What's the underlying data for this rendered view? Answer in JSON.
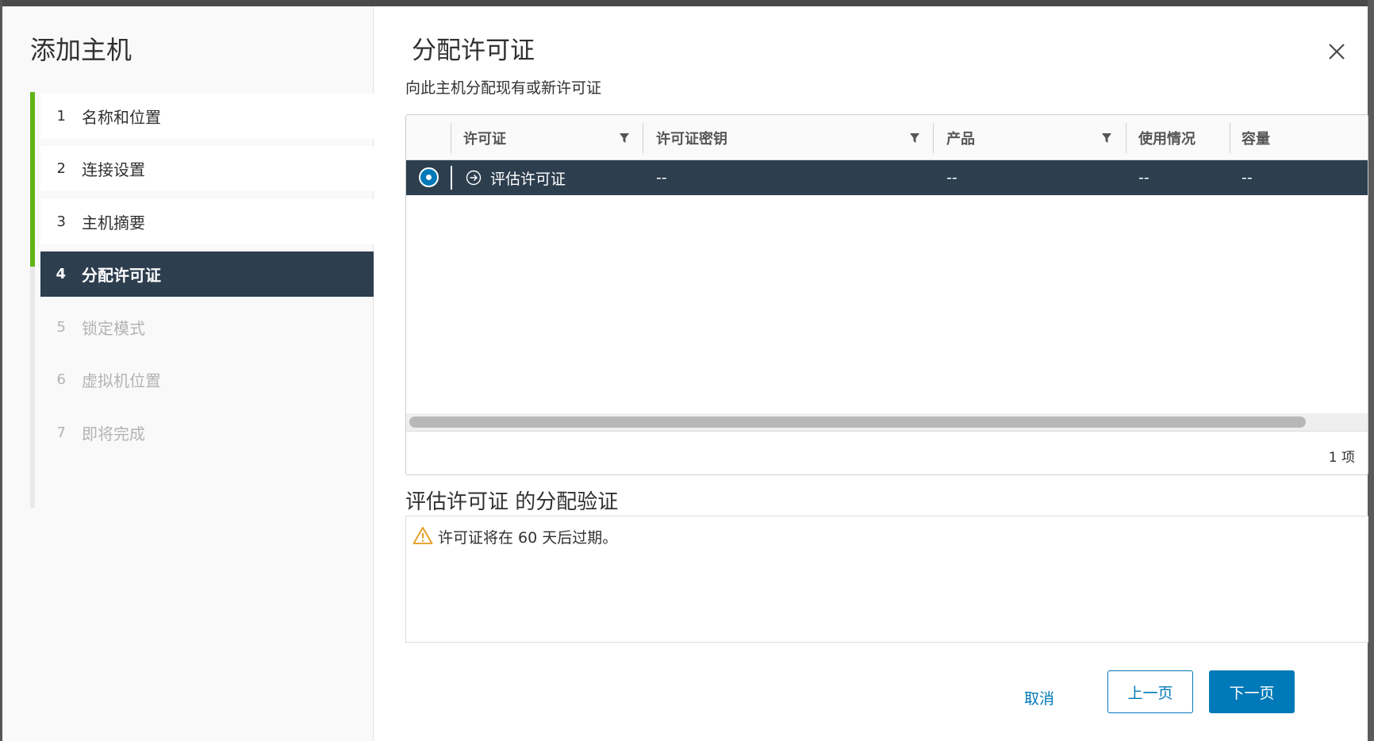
{
  "sidebar": {
    "title": "添加主机",
    "steps": [
      {
        "num": "1",
        "label": "名称和位置",
        "state": "done"
      },
      {
        "num": "2",
        "label": "连接设置",
        "state": "done"
      },
      {
        "num": "3",
        "label": "主机摘要",
        "state": "done"
      },
      {
        "num": "4",
        "label": "分配许可证",
        "state": "active"
      },
      {
        "num": "5",
        "label": "锁定模式",
        "state": "future"
      },
      {
        "num": "6",
        "label": "虚拟机位置",
        "state": "future"
      },
      {
        "num": "7",
        "label": "即将完成",
        "state": "future"
      }
    ]
  },
  "main": {
    "title": "分配许可证",
    "subtitle": "向此主机分配现有或新许可证",
    "close_icon": "close-icon"
  },
  "grid": {
    "columns": [
      "许可证",
      "许可证密钥",
      "产品",
      "使用情况",
      "容量"
    ],
    "rows": [
      {
        "selected": true,
        "license": "评估许可证",
        "key": "--",
        "product": "--",
        "usage": "--",
        "capacity": "--"
      }
    ],
    "footer_count": "1 项"
  },
  "validation": {
    "title": "评估许可证 的分配验证",
    "message": "许可证将在 60 天后过期。"
  },
  "footer": {
    "cancel": "取消",
    "back": "上一页",
    "next": "下一页"
  },
  "colors": {
    "accent": "#0079b8",
    "active_step_bg": "#2d3e4e",
    "done_indicator": "#60b515",
    "warning": "#e39a1a"
  }
}
